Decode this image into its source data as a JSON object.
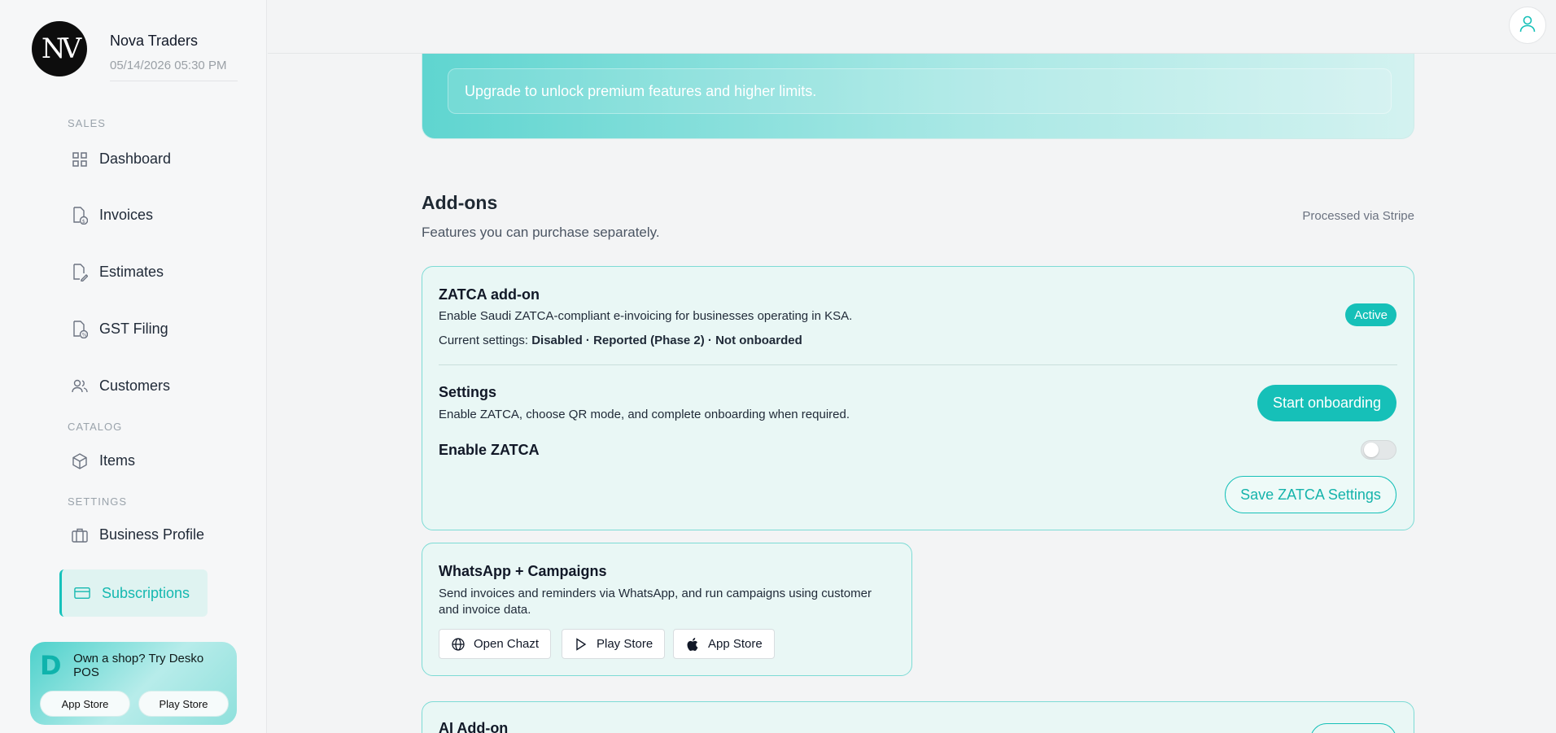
{
  "brand": {
    "logo": "NV",
    "name": "Nova Traders",
    "datetime": "05/14/2026 05:30 PM"
  },
  "sidebar": {
    "sections": {
      "sales": "SALES",
      "catalog": "CATALOG",
      "settings": "SETTINGS"
    },
    "items": [
      {
        "label": "Dashboard",
        "icon": "grid-icon"
      },
      {
        "label": "Invoices",
        "icon": "invoice-icon"
      },
      {
        "label": "Estimates",
        "icon": "estimate-icon"
      },
      {
        "label": "GST Filing",
        "icon": "gst-icon"
      },
      {
        "label": "Customers",
        "icon": "users-icon"
      },
      {
        "label": "Items",
        "icon": "box-icon"
      },
      {
        "label": "Business Profile",
        "icon": "briefcase-icon"
      },
      {
        "label": "Subscriptions",
        "icon": "card-icon",
        "active": true
      }
    ],
    "promo": {
      "logo": "D",
      "text": "Own a shop? Try Desko POS",
      "app_store": "App Store",
      "play_store": "Play Store"
    }
  },
  "banner": {
    "text": "Upgrade to unlock premium features and higher limits."
  },
  "addons": {
    "title": "Add-ons",
    "subtitle": "Features you can purchase separately.",
    "processed": "Processed via Stripe",
    "zatca": {
      "title": "ZATCA add-on",
      "desc": "Enable Saudi ZATCA-compliant e-invoicing for businesses operating in KSA.",
      "current_label": "Current settings:",
      "current_value": "Disabled · Reported (Phase 2) · Not onboarded",
      "badge": "Active",
      "settings_title": "Settings",
      "settings_desc": "Enable ZATCA, choose QR mode, and complete onboarding when required.",
      "onboard_btn": "Start onboarding",
      "enable_label": "Enable ZATCA",
      "enabled": false,
      "save_btn": "Save ZATCA Settings"
    },
    "whatsapp": {
      "title": "WhatsApp + Campaigns",
      "desc": "Send invoices and reminders via WhatsApp, and run campaigns using customer and invoice data.",
      "open_btn": "Open Chazt",
      "play_btn": "Play Store",
      "app_btn": "App Store"
    },
    "ai": {
      "title": "AI Add-on"
    }
  },
  "colors": {
    "accent": "#16c0b8",
    "card_bg": "#e9f7f5",
    "card_border": "#7ddbd5"
  }
}
